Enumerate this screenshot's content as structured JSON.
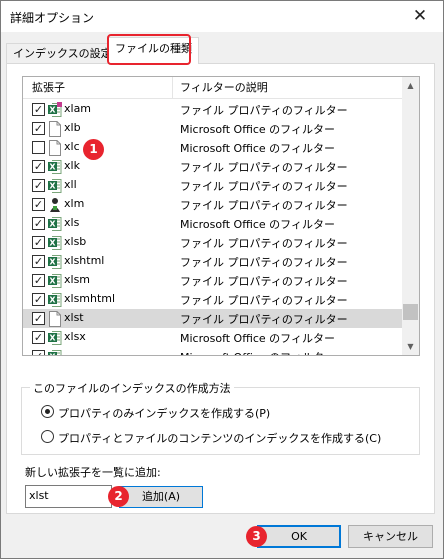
{
  "window": {
    "title": "詳細オプション",
    "close_glyph": "✕"
  },
  "tabs": [
    {
      "label": "インデックスの設定"
    },
    {
      "label": "ファイルの種類"
    }
  ],
  "list": {
    "columns": [
      "拡張子",
      "フィルターの説明"
    ],
    "rows": [
      {
        "ext": "xlam",
        "filter": "ファイル プロパティのフィルター",
        "checked": true,
        "icon": "excel-addin-icon"
      },
      {
        "ext": "xlb",
        "filter": "Microsoft Office のフィルター",
        "checked": true,
        "icon": "blank-file-icon"
      },
      {
        "ext": "xlc",
        "filter": "Microsoft Office のフィルター",
        "checked": false,
        "icon": "blank-file-icon"
      },
      {
        "ext": "xlk",
        "filter": "ファイル プロパティのフィルター",
        "checked": true,
        "icon": "excel-file-icon"
      },
      {
        "ext": "xll",
        "filter": "ファイル プロパティのフィルター",
        "checked": true,
        "icon": "excel-file-icon"
      },
      {
        "ext": "xlm",
        "filter": "ファイル プロパティのフィルター",
        "checked": true,
        "icon": "macro-file-icon"
      },
      {
        "ext": "xls",
        "filter": "Microsoft Office のフィルター",
        "checked": true,
        "icon": "excel-file-icon"
      },
      {
        "ext": "xlsb",
        "filter": "ファイル プロパティのフィルター",
        "checked": true,
        "icon": "excel-file-icon"
      },
      {
        "ext": "xlshtml",
        "filter": "ファイル プロパティのフィルター",
        "checked": true,
        "icon": "excel-file-icon"
      },
      {
        "ext": "xlsm",
        "filter": "ファイル プロパティのフィルター",
        "checked": true,
        "icon": "excel-file-icon"
      },
      {
        "ext": "xlsmhtml",
        "filter": "ファイル プロパティのフィルター",
        "checked": true,
        "icon": "excel-file-icon"
      },
      {
        "ext": "xlst",
        "filter": "ファイル プロパティのフィルター",
        "checked": true,
        "icon": "blank-file-icon",
        "selected": true
      },
      {
        "ext": "xlsx",
        "filter": "Microsoft Office のフィルター",
        "checked": true,
        "icon": "excel-file-icon"
      },
      {
        "ext": "",
        "filter": "Microsoft Office のフィルター",
        "checked": true,
        "icon": "excel-file-icon"
      }
    ],
    "scroll_position": 0.92
  },
  "index_method": {
    "label": "このファイルのインデックスの作成方法",
    "options": [
      {
        "label": "プロパティのみインデックスを作成する(P)",
        "selected": true
      },
      {
        "label": "プロパティとファイルのコンテンツのインデックスを作成する(C)",
        "selected": false
      }
    ]
  },
  "add": {
    "label": "新しい拡張子を一覧に追加:",
    "input_value": "xlst",
    "button_label": "追加(A)"
  },
  "footer": {
    "ok_label": "OK",
    "cancel_label": "キャンセル"
  },
  "annotations": [
    "1",
    "2",
    "3"
  ],
  "colors": {
    "annotation": "#e8242e",
    "focus": "#0078d7",
    "excel_green": "#1e7145"
  }
}
